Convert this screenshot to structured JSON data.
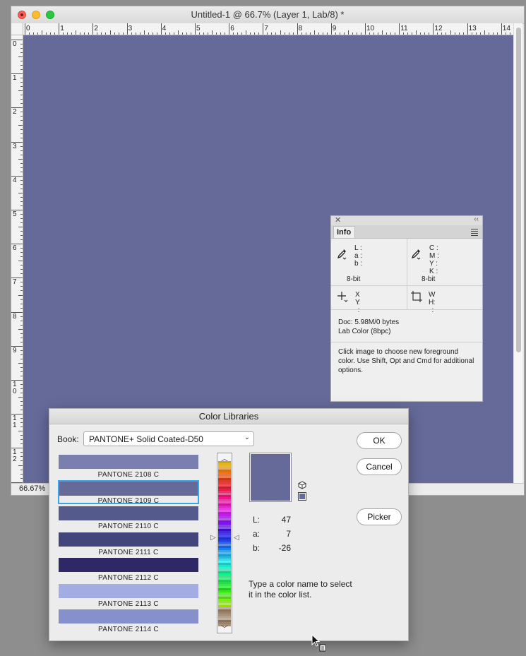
{
  "document": {
    "title": "Untitled-1 @ 66.7% (Layer 1, Lab/8) *",
    "zoom": "66.67%",
    "canvas_color": "#656a99",
    "ruler_h_labels": [
      "0",
      "1",
      "2",
      "3",
      "4",
      "5",
      "6",
      "7",
      "8",
      "9",
      "10",
      "11",
      "12",
      "13",
      "14"
    ],
    "ruler_v_labels": [
      "0",
      "1",
      "2",
      "3",
      "4",
      "5",
      "6",
      "7",
      "8",
      "9",
      "1\n0",
      "1\n1",
      "1\n2",
      "1"
    ]
  },
  "info_panel": {
    "tab": "Info",
    "lab_labels": [
      "L :",
      "a :",
      "b :"
    ],
    "cmyk_labels": [
      "C :",
      "M :",
      "Y :",
      "K :"
    ],
    "bitdepth_left": "8-bit",
    "bitdepth_right": "8-bit",
    "xy_labels": [
      "X :",
      "Y :"
    ],
    "wh_labels": [
      "W :",
      "H :"
    ],
    "doc_size": "Doc: 5.98M/0 bytes",
    "color_mode": "Lab Color (8bpc)",
    "hint": "Click image to choose new foreground color.  Use Shift, Opt and Cmd for additional options."
  },
  "color_libraries": {
    "title": "Color Libraries",
    "book_label": "Book:",
    "book_value": "PANTONE+ Solid Coated-D50",
    "swatches": [
      {
        "label": "PANTONE 2108 C",
        "color": "#7a80ad",
        "selected": false
      },
      {
        "label": "PANTONE 2109 C",
        "color": "#656a99",
        "selected": true
      },
      {
        "label": "PANTONE 2110 C",
        "color": "#555a8c",
        "selected": false
      },
      {
        "label": "PANTONE 2111 C",
        "color": "#42467a",
        "selected": false
      },
      {
        "label": "PANTONE 2112 C",
        "color": "#2e2866",
        "selected": false
      },
      {
        "label": "PANTONE 2113 C",
        "color": "#a3ade4",
        "selected": false
      },
      {
        "label": "PANTONE 2114 C",
        "color": "#8590cc",
        "selected": false
      }
    ],
    "preview_color": "#656a99",
    "lab_values": [
      {
        "label": "L:",
        "value": "47"
      },
      {
        "label": "a:",
        "value": "7"
      },
      {
        "label": "b:",
        "value": "-26"
      }
    ],
    "hint": "Type a color name to select it in the color list.",
    "buttons": {
      "ok": "OK",
      "cancel": "Cancel",
      "picker": "Picker"
    }
  }
}
